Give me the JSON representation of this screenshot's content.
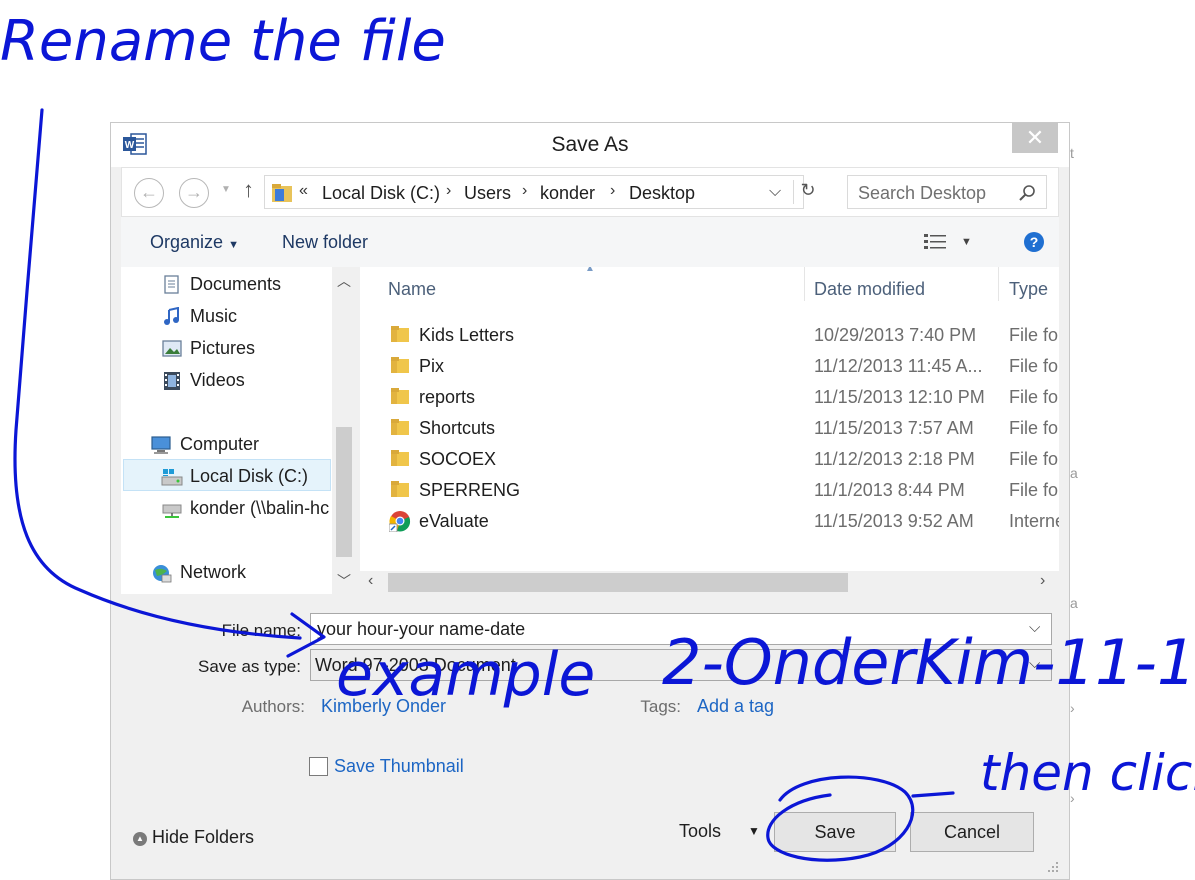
{
  "window": {
    "title": "Save As",
    "app_icon": "word-icon",
    "close_icon": "close-icon"
  },
  "nav": {
    "back_icon": "arrow-left-icon",
    "forward_icon": "arrow-right-icon",
    "up_icon": "arrow-up-icon",
    "breadcrumb_prefix": "«",
    "breadcrumbs": [
      "Local Disk (C:)",
      "Users",
      "konder",
      "Desktop"
    ],
    "search_placeholder": "Search Desktop"
  },
  "toolbar": {
    "organize": "Organize",
    "new_folder": "New folder"
  },
  "sidebar": {
    "items": [
      {
        "label": "Documents",
        "icon": "documents-icon"
      },
      {
        "label": "Music",
        "icon": "music-icon"
      },
      {
        "label": "Pictures",
        "icon": "pictures-icon"
      },
      {
        "label": "Videos",
        "icon": "videos-icon"
      },
      {
        "label": "Computer",
        "icon": "computer-icon"
      },
      {
        "label": "Local Disk (C:)",
        "icon": "local-disk-icon",
        "selected": true
      },
      {
        "label": "konder (\\\\balin-hc",
        "icon": "network-drive-icon"
      },
      {
        "label": "Network",
        "icon": "network-icon"
      }
    ]
  },
  "files": {
    "columns": [
      "Name",
      "Date modified",
      "Type"
    ],
    "rows": [
      {
        "name": "Kids Letters",
        "date": "10/29/2013 7:40 PM",
        "type": "File fol",
        "icon": "folder-icon"
      },
      {
        "name": "Pix",
        "date": "11/12/2013 11:45 A...",
        "type": "File fol",
        "icon": "folder-icon"
      },
      {
        "name": "reports",
        "date": "11/15/2013 12:10 PM",
        "type": "File fol",
        "icon": "folder-icon"
      },
      {
        "name": "Shortcuts",
        "date": "11/15/2013 7:57 AM",
        "type": "File fol",
        "icon": "folder-icon"
      },
      {
        "name": "SOCOEX",
        "date": "11/12/2013 2:18 PM",
        "type": "File fol",
        "icon": "folder-icon"
      },
      {
        "name": "SPERRENG",
        "date": "11/1/2013 8:44 PM",
        "type": "File fol",
        "icon": "folder-icon"
      },
      {
        "name": "eValuate",
        "date": "11/15/2013 9:52 AM",
        "type": "Interne",
        "icon": "chrome-icon"
      }
    ]
  },
  "form": {
    "file_name_label": "File name:",
    "file_name_value": "your hour-your name-date",
    "save_type_label": "Save as type:",
    "save_type_value": "Word 97-2003 Document",
    "authors_label": "Authors:",
    "authors_value": "Kimberly Onder",
    "tags_label": "Tags:",
    "tags_value": "Add a tag",
    "save_thumbnail": "Save Thumbnail"
  },
  "footer": {
    "hide_folders": "Hide Folders",
    "tools": "Tools",
    "save": "Save",
    "cancel": "Cancel"
  },
  "colors": {
    "ink": "#0b16d6",
    "link": "#1d66c4",
    "selection": "#e5f3fb"
  }
}
